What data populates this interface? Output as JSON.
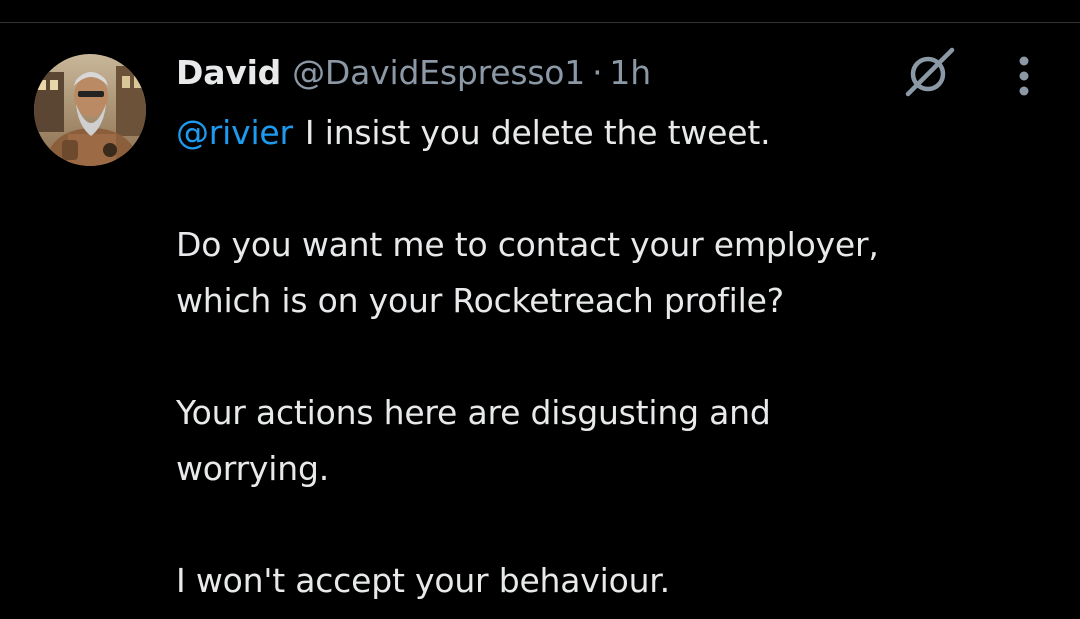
{
  "tweet": {
    "author": {
      "display_name": "David",
      "handle": "@DavidEspresso1",
      "avatar_icon": "avatar-photo"
    },
    "separator": "·",
    "timestamp": "1h",
    "actions": {
      "grok_icon": "grok-icon",
      "more_icon": "more-options-icon"
    },
    "mention": "@rivier",
    "first_line_text": "I insist you delete the tweet.",
    "paragraphs": [
      [
        "Do you want me to contact your employer,",
        "which is on your Rocketreach profile?"
      ],
      [
        "Your actions here are disgusting and",
        "worrying."
      ],
      [
        "I won't accept your behaviour."
      ]
    ]
  },
  "colors": {
    "background": "#000000",
    "text": "#e7e9ea",
    "secondary": "#8b98a5",
    "link": "#1d9bf0",
    "divider": "#2f3336"
  }
}
